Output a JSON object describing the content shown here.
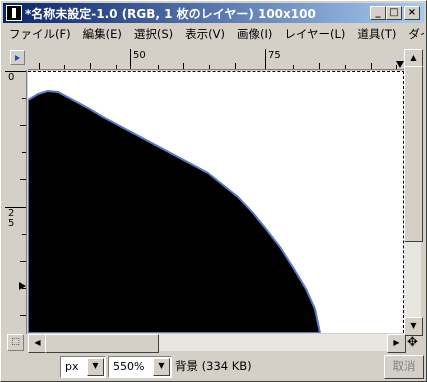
{
  "window": {
    "title": "*名称未設定-1.0 (RGB, 1 枚のレイヤー) 100x100",
    "controls": {
      "minimize": "_",
      "maximize": "□",
      "close": "×"
    }
  },
  "menu": {
    "items": [
      "ファイル(F)",
      "編集(E)",
      "選択(S)",
      "表示(V)",
      "画像(I)",
      "レイヤー(L)",
      "道具(T)",
      "ダイ"
    ]
  },
  "rulers": {
    "horizontal_labels": [
      "50",
      "75"
    ],
    "vertical_labels": [
      "0",
      "2\n5"
    ]
  },
  "statusbar": {
    "unit": "px",
    "zoom": "550%",
    "layer_info": "背景 (334 KB)",
    "cancel_label": "取消"
  },
  "colors": {
    "title_start": "#0a246a",
    "title_end": "#a6caf0",
    "shape_fill": "#000000",
    "edge_tint": "#5a7bc4"
  },
  "icons": {
    "app": "gimp-image-icon",
    "quickmask": "quickmask-icon",
    "navigate": "navigate-move-icon"
  }
}
